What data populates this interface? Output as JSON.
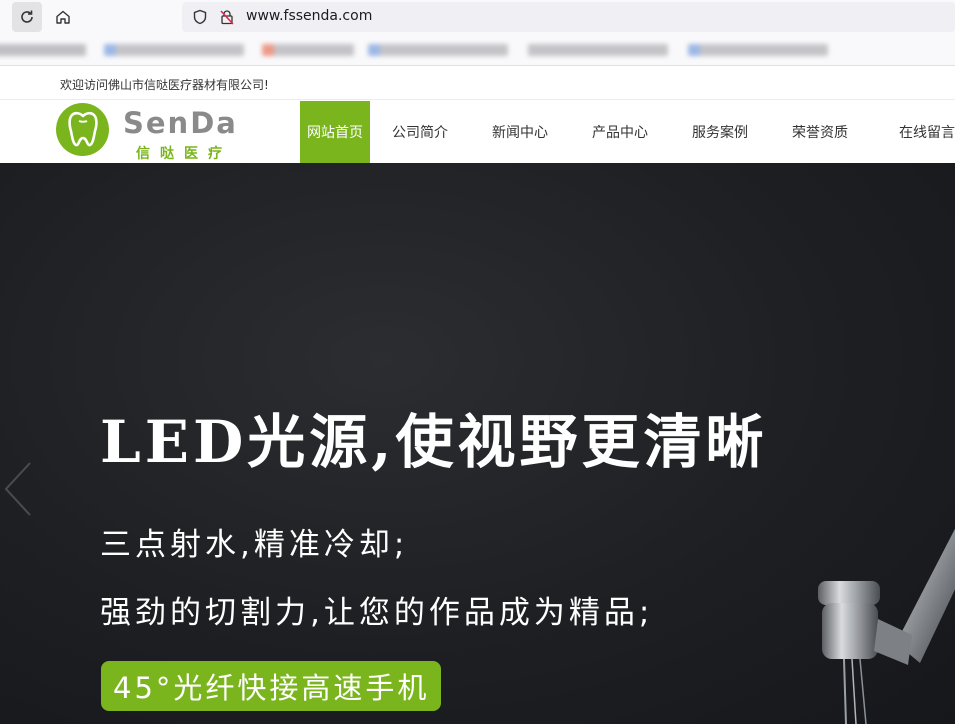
{
  "browser": {
    "url": "www.fssenda.com",
    "icons": [
      "reload-icon",
      "home-icon",
      "shield-icon",
      "insecure-lock-icon"
    ]
  },
  "site": {
    "welcome": "欢迎访问佛山市信哒医疗器材有限公司!",
    "logo": {
      "en": "SenDa",
      "cn": "信哒医疗"
    },
    "brand_color": "#7ab51d",
    "nav": [
      {
        "label": "网站首页",
        "active": true
      },
      {
        "label": "公司简介",
        "active": false
      },
      {
        "label": "新闻中心",
        "active": false
      },
      {
        "label": "产品中心",
        "active": false
      },
      {
        "label": "服务案例",
        "active": false
      },
      {
        "label": "荣誉资质",
        "active": false
      },
      {
        "label": "在线留言",
        "active": false
      }
    ]
  },
  "hero": {
    "title": "LED光源,使视野更清晰",
    "line1": "三点射水,精准冷却;",
    "line2": "强劲的切割力,让您的作品成为精品;",
    "badge": "45°光纤快接高速手机"
  }
}
